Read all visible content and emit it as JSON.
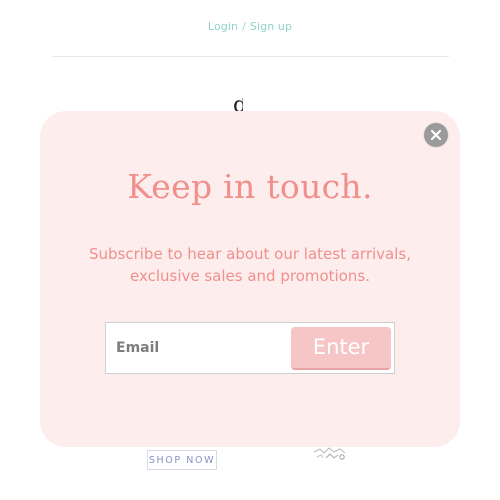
{
  "header": {
    "login_label": "Login",
    "separator": "/",
    "signup_label": "Sign up"
  },
  "background": {
    "logo_fragment": "d",
    "shop_now_label": "SHOP NOW"
  },
  "popup": {
    "title": "Keep in touch.",
    "subtitle": "Subscribe to hear about our latest arrivals, exclusive sales and promotions.",
    "email_placeholder": "Email",
    "email_value": "",
    "submit_label": "Enter",
    "close_icon": "close-icon"
  },
  "colors": {
    "popup_bg": "#fdeeed",
    "accent_pink": "#f08f8c",
    "button_pink": "#f6c5c5",
    "nav_teal": "#8fd3c6",
    "shop_now_text": "#8b8fc6",
    "close_gray": "#9a9a9a"
  }
}
